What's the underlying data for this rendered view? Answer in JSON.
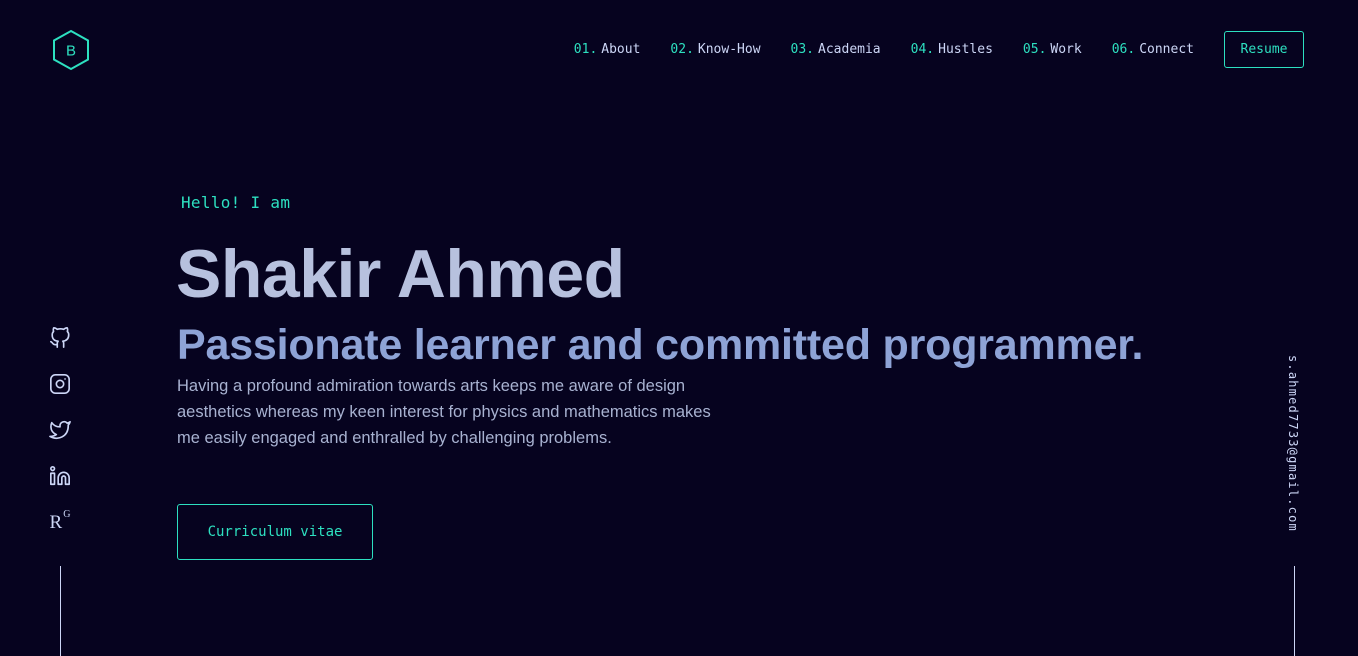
{
  "logo": {
    "letter": "B"
  },
  "nav": {
    "items": [
      {
        "num": "01.",
        "label": "About"
      },
      {
        "num": "02.",
        "label": "Know-How"
      },
      {
        "num": "03.",
        "label": "Academia"
      },
      {
        "num": "04.",
        "label": "Hustles"
      },
      {
        "num": "05.",
        "label": "Work"
      },
      {
        "num": "06.",
        "label": "Connect"
      }
    ],
    "resume_label": "Resume"
  },
  "hero": {
    "greeting": "Hello! I am",
    "name": "Shakir Ahmed",
    "tagline": "Passionate learner and committed programmer.",
    "description": "Having a profound admiration towards arts keeps me aware of design aesthetics whereas my keen interest for physics and mathematics makes me easily engaged and enthralled by challenging problems.",
    "cv_button": "Curriculum vitae"
  },
  "social": {
    "icons": [
      "github-icon",
      "instagram-icon",
      "twitter-icon",
      "linkedin-icon",
      "researchgate-icon"
    ],
    "researchgate_text": {
      "main": "R",
      "sup": "G"
    }
  },
  "email": "s.ahmed7733@gmail.com",
  "colors": {
    "background": "#06031f",
    "accent": "#2de0c0",
    "heading": "#b7c1de",
    "subheading": "#8ea3d6",
    "text": "#a8b2d1"
  }
}
